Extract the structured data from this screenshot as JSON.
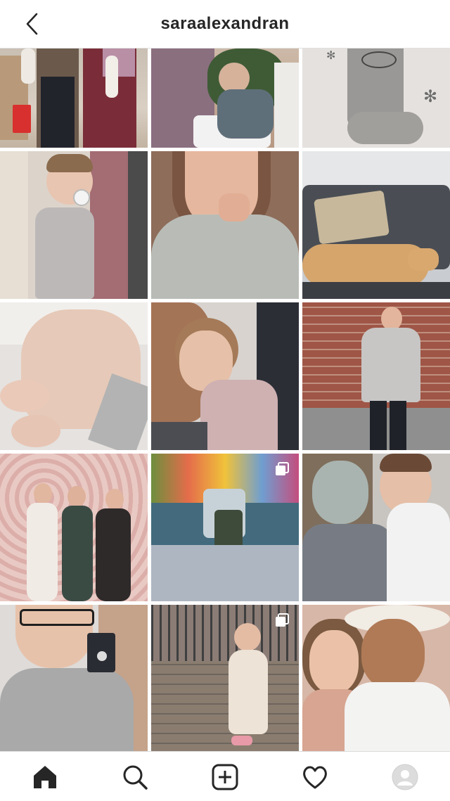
{
  "header": {
    "username": "saraalexandran",
    "back_icon": "chevron-left-icon"
  },
  "posts": [
    {
      "id": "post-1",
      "subject": "holiday-family-feet",
      "multi": false
    },
    {
      "id": "post-2",
      "subject": "baby-christmas-tree",
      "multi": false
    },
    {
      "id": "post-3",
      "subject": "knitted-sock",
      "multi": false
    },
    {
      "id": "post-4",
      "subject": "toddler-pacifier",
      "multi": false
    },
    {
      "id": "post-5",
      "subject": "woman-knit-sweater-selfie",
      "multi": false
    },
    {
      "id": "post-6",
      "subject": "dog-on-sofa",
      "multi": false
    },
    {
      "id": "post-7",
      "subject": "pink-knit-yarn-basket",
      "multi": false
    },
    {
      "id": "post-8",
      "subject": "girl-with-dog",
      "multi": false
    },
    {
      "id": "post-9",
      "subject": "woman-grey-sweater-brick-wall",
      "multi": false
    },
    {
      "id": "post-10",
      "subject": "three-women-flower-wall",
      "multi": false
    },
    {
      "id": "post-11",
      "subject": "fairground-ride",
      "multi": true
    },
    {
      "id": "post-12",
      "subject": "face-mask-with-baby",
      "multi": false
    },
    {
      "id": "post-13",
      "subject": "ring-box-selfie",
      "multi": false
    },
    {
      "id": "post-14",
      "subject": "girl-in-dress-outdoors",
      "multi": true
    },
    {
      "id": "post-15",
      "subject": "couple-selfie",
      "multi": false
    }
  ],
  "tabbar": {
    "tabs": [
      {
        "name": "home",
        "icon": "home-icon",
        "active": true
      },
      {
        "name": "search",
        "icon": "search-icon",
        "active": false
      },
      {
        "name": "create",
        "icon": "plus-square-icon",
        "active": false
      },
      {
        "name": "activity",
        "icon": "heart-icon",
        "active": false
      },
      {
        "name": "profile",
        "icon": "avatar-icon",
        "active": false
      }
    ]
  },
  "colors": {
    "text": "#262626",
    "divider": "#dbdbdb",
    "background": "#ffffff"
  }
}
